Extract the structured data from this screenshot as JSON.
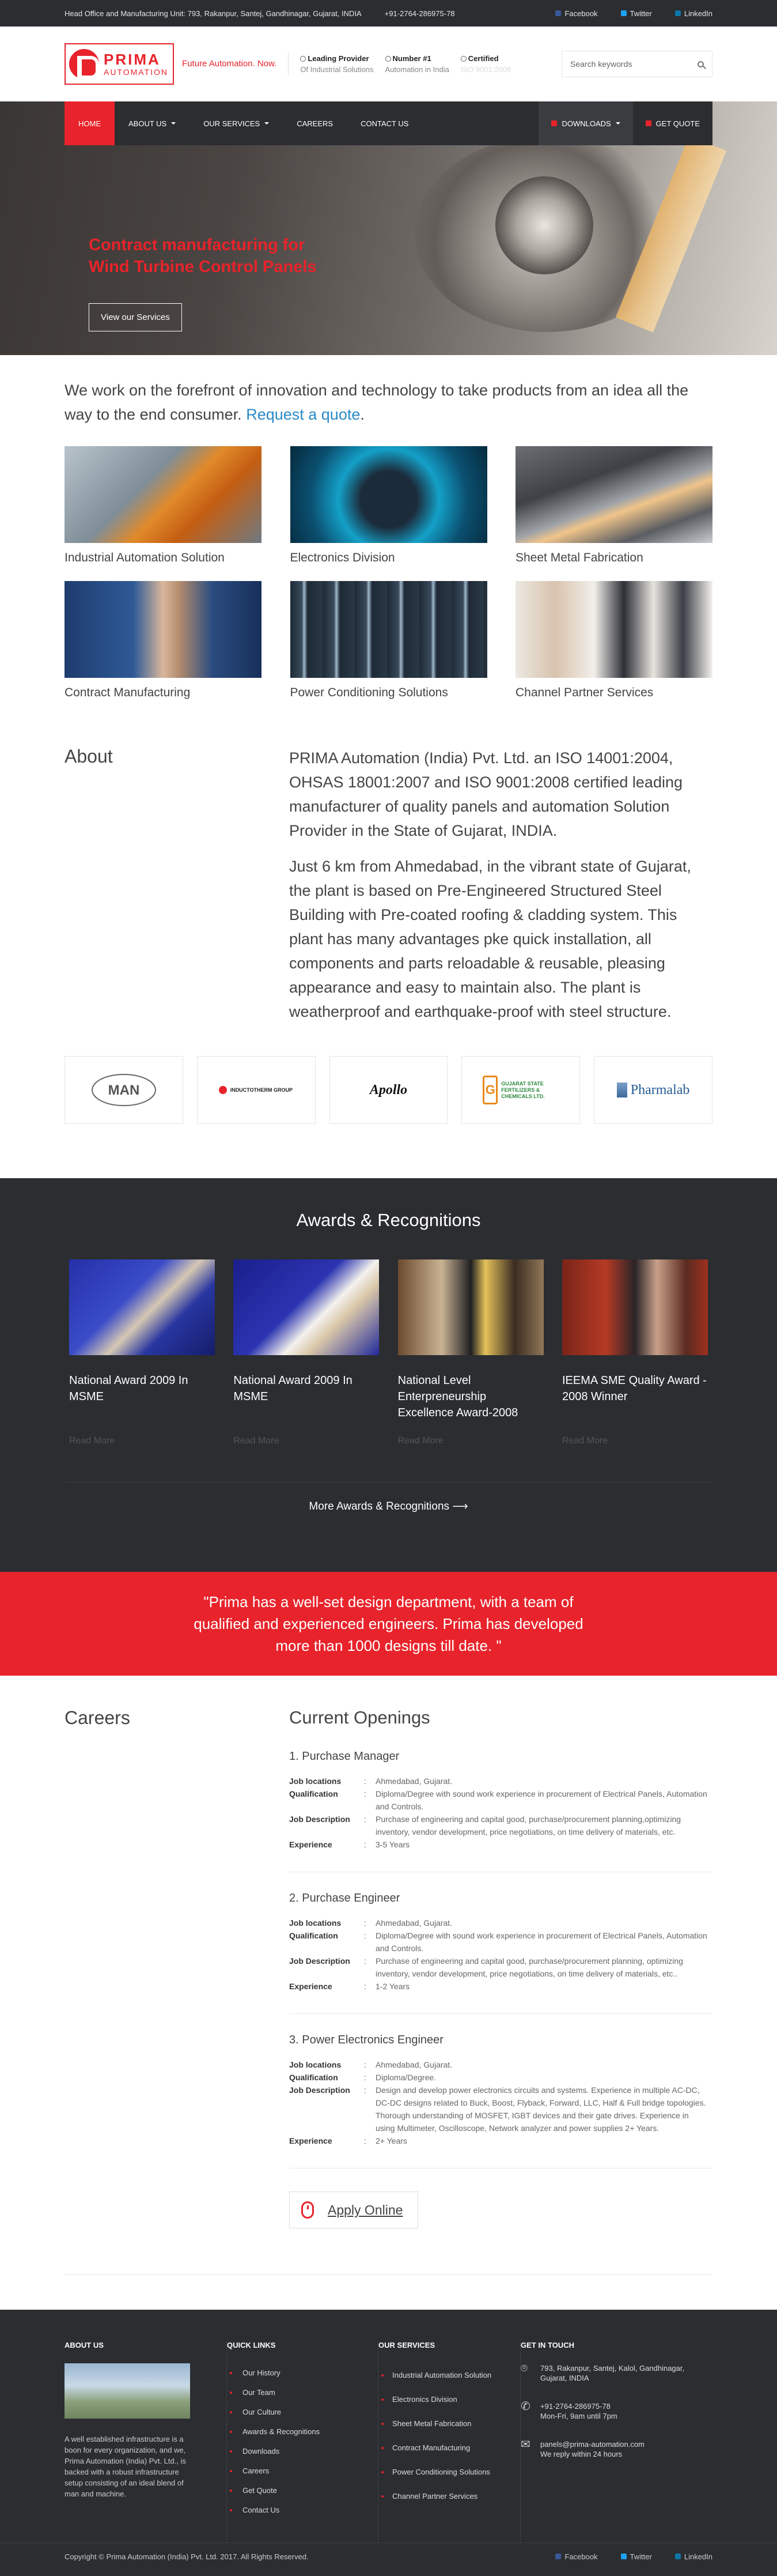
{
  "topbar": {
    "address": "Head Office and Manufacturing Unit: 793, Rakanpur, Santej, Gandhinagar, Gujarat, INDIA",
    "phone": "+91-2764-286975-78",
    "social": [
      "Facebook",
      "Twitter",
      "LinkedIn"
    ]
  },
  "header": {
    "logo_line1": "PRIMA",
    "logo_line2": "AUTOMATION",
    "tagline": "Future Automation. Now.",
    "features": [
      {
        "title": "Leading Provider",
        "sub": "Of Industrial Solutions"
      },
      {
        "title": "Number #1",
        "sub": "Automation in India"
      },
      {
        "title": "Certified",
        "sub": "ISO 9001:2008"
      }
    ],
    "search_placeholder": "Search keywords"
  },
  "nav": {
    "items": [
      "HOME",
      "ABOUT US",
      "OUR SERVICES",
      "CAREERS",
      "CONTACT US"
    ],
    "downloads": "DOWNLOADS",
    "get_quote": "GET QUOTE"
  },
  "hero": {
    "line1": "Contract manufacturing for",
    "line2": "Wind Turbine Control Panels",
    "button": "View our Services"
  },
  "intro": {
    "text": "We work on the forefront of innovation and technology to take products from an idea all the way to the end consumer.",
    "link": "Request a quote",
    "tail": "."
  },
  "services": [
    "Industrial Automation Solution",
    "Electronics Division",
    "Sheet Metal Fabrication",
    "Contract Manufacturing",
    "Power Conditioning Solutions",
    "Channel Partner Services"
  ],
  "about": {
    "title": "About",
    "p1": "PRIMA Automation (India) Pvt. Ltd. an ISO 14001:2004, OHSAS 18001:2007 and ISO 9001:2008 certified leading manufacturer of quality panels and automation Solution Provider in the State of Gujarat, INDIA.",
    "p2": "Just 6 km from Ahmedabad, in the vibrant state of Gujarat, the plant is based on Pre-Engineered Structured Steel Building with Pre-coated roofing & cladding system. This plant has many advantages pke quick installation, all components and parts reloadable & reusable, pleasing appearance and easy to maintain also. The plant is weatherproof and earthquake-proof with steel structure."
  },
  "clients": [
    "MAN",
    "INDUCTOTHERM GROUP",
    "Apollo",
    "GUJARAT STATE FERTILIZERS & CHEMICALS LTD.",
    "Pharmalab"
  ],
  "awards": {
    "title": "Awards & Recognitions",
    "items": [
      {
        "title": "National Award 2009 In MSME",
        "more": "Read More"
      },
      {
        "title": "National Award 2009 In MSME",
        "more": "Read More"
      },
      {
        "title": "National Level Enterpreneurship Excellence Award-2008",
        "more": "Read More"
      },
      {
        "title": "IEEMA SME Quality Award - 2008 Winner",
        "more": "Read More"
      }
    ],
    "more": "More Awards & Recognitions"
  },
  "quote": "\"Prima has a well-set design department, with a team of qualified and experienced engineers. Prima has developed more than 1000 designs till date. \"",
  "careers": {
    "title": "Careers",
    "openings_title": "Current Openings",
    "labels": {
      "loc": "Job locations",
      "qual": "Qualification",
      "desc": "Job Description",
      "exp": "Experience",
      "sep": ":"
    },
    "jobs": [
      {
        "title": "1. Purchase Manager",
        "loc": "Ahmedabad, Gujarat.",
        "qual": "Diploma/Degree with sound work experience in procurement of Electrical Panels, Automation and Controls.",
        "desc": "Purchase of engineering and capital good, purchase/procurement planning,optimizing inventory, vendor development, price negotiations, on time delivery of materials, etc.",
        "exp": "3-5 Years"
      },
      {
        "title": "2. Purchase Engineer",
        "loc": "Ahmedabad, Gujarat.",
        "qual": "Diploma/Degree with sound work experience in procurement of Electrical Panels, Automation and Controls.",
        "desc": "Purchase of engineering and capital good, purchase/procurement planning, optimizing inventory, vendor development, price negotiations, on time delivery of materials, etc..",
        "exp": "1-2 Years"
      },
      {
        "title": "3. Power Electronics Engineer",
        "loc": "Ahmedabad, Gujarat.",
        "qual": "Diploma/Degree.",
        "desc": "Design and develop power electronics circuits and systems. Experience in multiple AC-DC, DC-DC designs related to Buck, Boost, Flyback, Forward, LLC, Half & Full bridge topologies. Thorough understanding of MOSFET, IGBT devices and their gate drives. Experience in using Multimeter, Oscilloscope, Network analyzer and power supplies 2+ Years.",
        "exp": "2+ Years"
      }
    ],
    "apply": "Apply Online"
  },
  "footer": {
    "about_title": "ABOUT US",
    "about_text": "A well established infrastructure is a boon for every organization, and we, Prima Automation (India) Pvt. Ltd., is backed with a robust infrastructure setup consisting of an ideal blend of man and machine.",
    "quick_title": "QUICK LINKS",
    "quick": [
      "Our History",
      "Our Team",
      "Our Culture",
      "Awards & Recognitions",
      "Downloads",
      "Careers",
      "Get Quote",
      "Contact Us"
    ],
    "services_title": "OUR SERVICES",
    "services": [
      "Industrial Automation Solution",
      "Electronics Division",
      "Sheet Metal Fabrication",
      "Contract Manufacturing",
      "Power Conditioning Solutions",
      "Channel Partner Services"
    ],
    "touch_title": "GET IN TOUCH",
    "address": "793, Rakanpur, Santej, Kalol, Gandhinagar, Gujarat, INDIA",
    "phone": "+91-2764-286975-78",
    "hours": "Mon-Fri, 9am until 7pm",
    "email": "panels@prima-automation.com",
    "email_note": "We reply within 24 hours",
    "copyright": "Copyright © Prima Automation (India) Pvt. Ltd. 2017. All Rights Reserved.",
    "social": [
      "Facebook",
      "Twitter",
      "LinkedIn"
    ]
  }
}
